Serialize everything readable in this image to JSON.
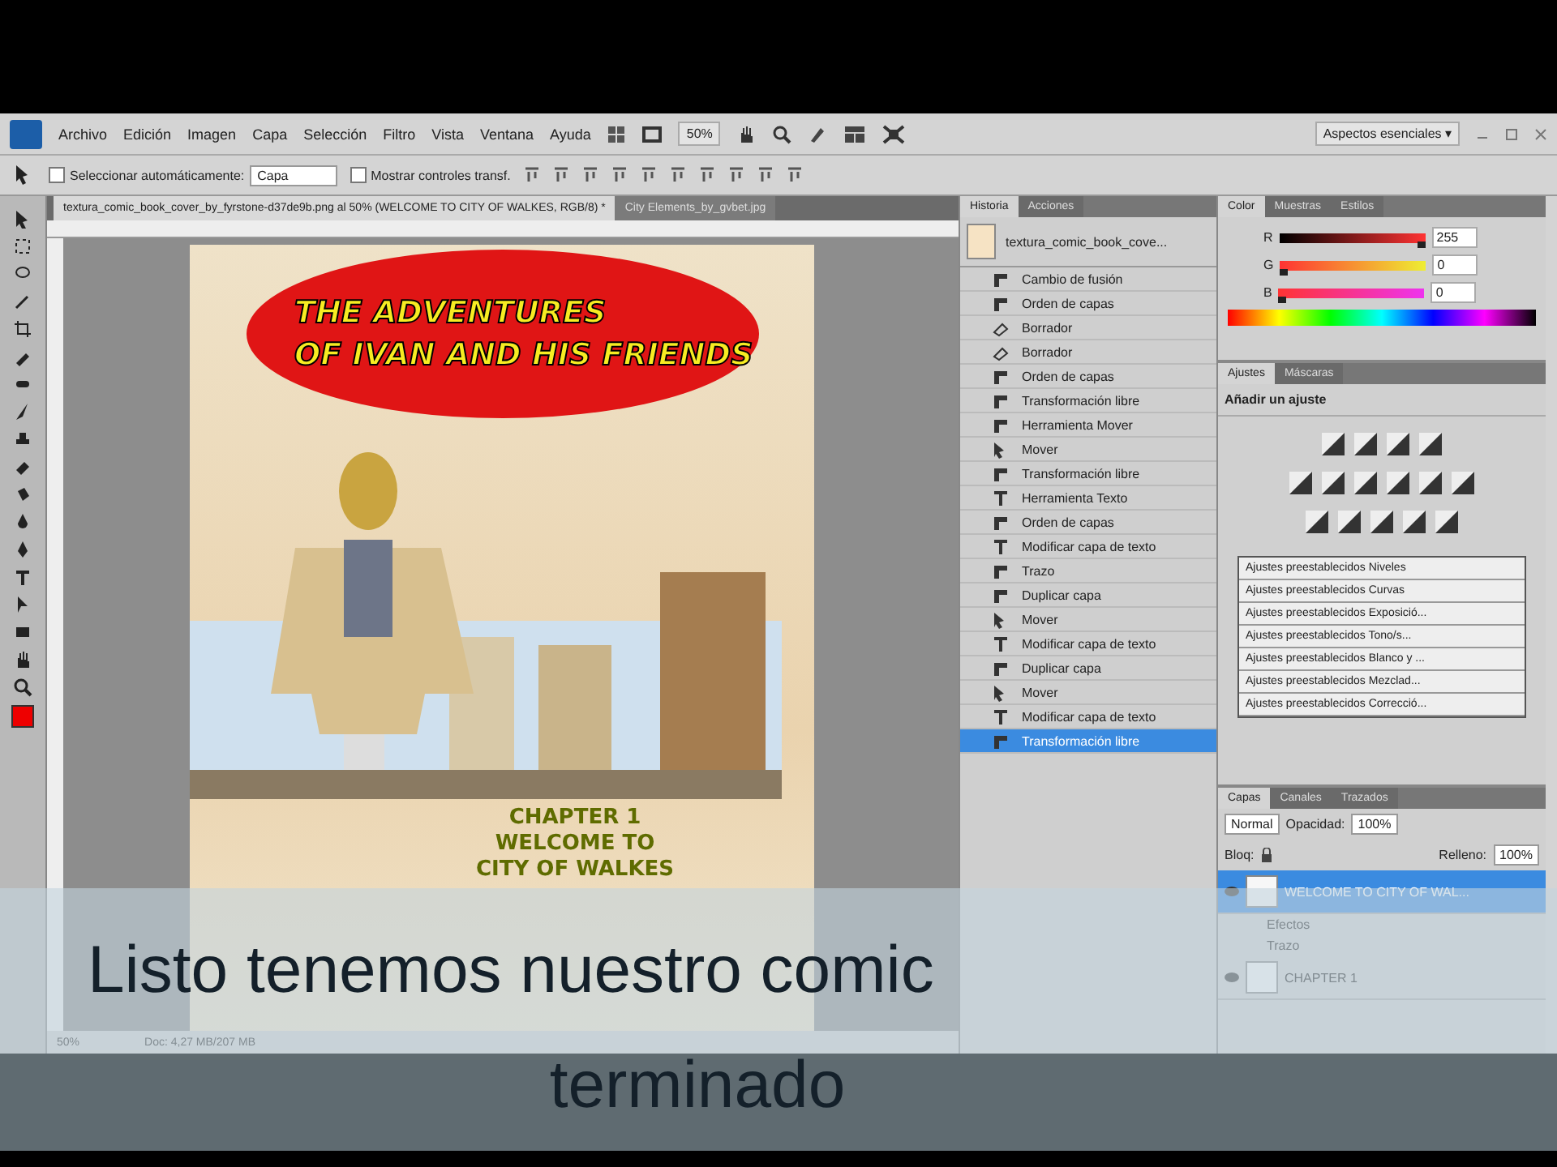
{
  "menu_bar": {
    "menus": [
      "Archivo",
      "Edición",
      "Imagen",
      "Capa",
      "Selección",
      "Filtro",
      "Vista",
      "Ventana",
      "Ayuda"
    ],
    "zoom": "50%",
    "workspace": "Aspectos esenciales ▾"
  },
  "options_bar": {
    "auto_select": {
      "label": "Seleccionar automáticamente:",
      "checked": false,
      "value": "Capa"
    },
    "show_transform": {
      "label": "Mostrar controles transf.",
      "checked": false
    }
  },
  "document_tabs": [
    {
      "label": "textura_comic_book_cover_by_fyrstone-d37de9b.png al 50% (WELCOME TO CITY OF WALKES, RGB/8) *",
      "selected": true
    },
    {
      "label": "City Elements_by_gvbet.jpg",
      "selected": false
    }
  ],
  "canvas": {
    "title_lines": [
      "THE ADVENTURES",
      "OF IVAN AND HIS FRIENDS"
    ],
    "chapter_lines": [
      "CHAPTER 1",
      "WELCOME TO",
      "CITY OF WALKES"
    ]
  },
  "status_bar": {
    "zoom": "50%",
    "doc": "Doc: 4,27 MB/207 MB"
  },
  "history_panel": {
    "tabs": [
      {
        "label": "Historia",
        "selected": true
      },
      {
        "label": "Acciones",
        "selected": false
      }
    ],
    "snapshot": "textura_comic_book_cove...",
    "items": [
      {
        "label": "Cambio de fusión",
        "kind": "layer",
        "selected": false
      },
      {
        "label": "Orden de capas",
        "kind": "layer",
        "selected": false
      },
      {
        "label": "Borrador",
        "kind": "eraser",
        "selected": false
      },
      {
        "label": "Borrador",
        "kind": "eraser",
        "selected": false
      },
      {
        "label": "Orden de capas",
        "kind": "layer",
        "selected": false
      },
      {
        "label": "Transformación libre",
        "kind": "layer",
        "selected": false
      },
      {
        "label": "Herramienta Mover",
        "kind": "layer",
        "selected": false
      },
      {
        "label": "Mover",
        "kind": "move",
        "selected": false
      },
      {
        "label": "Transformación libre",
        "kind": "layer",
        "selected": false
      },
      {
        "label": "Herramienta Texto",
        "kind": "text",
        "selected": false
      },
      {
        "label": "Orden de capas",
        "kind": "layer",
        "selected": false
      },
      {
        "label": "Modificar capa de texto",
        "kind": "text",
        "selected": false
      },
      {
        "label": "Trazo",
        "kind": "layer",
        "selected": false
      },
      {
        "label": "Duplicar capa",
        "kind": "layer",
        "selected": false
      },
      {
        "label": "Mover",
        "kind": "move",
        "selected": false
      },
      {
        "label": "Modificar capa de texto",
        "kind": "text",
        "selected": false
      },
      {
        "label": "Duplicar capa",
        "kind": "layer",
        "selected": false
      },
      {
        "label": "Mover",
        "kind": "move",
        "selected": false
      },
      {
        "label": "Modificar capa de texto",
        "kind": "text",
        "selected": false
      },
      {
        "label": "Transformación libre",
        "kind": "layer",
        "selected": true
      }
    ]
  },
  "color_panel": {
    "tabs": [
      {
        "label": "Color",
        "selected": true
      },
      {
        "label": "Muestras",
        "selected": false
      },
      {
        "label": "Estilos",
        "selected": false
      }
    ],
    "channels": [
      {
        "name": "R",
        "level": 1,
        "value": "255"
      },
      {
        "name": "G",
        "level": 0,
        "value": "0"
      },
      {
        "name": "B",
        "level": 0,
        "value": "0"
      }
    ]
  },
  "adjustments_panel": {
    "tabs": [
      {
        "label": "Ajustes",
        "selected": true
      },
      {
        "label": "Máscaras",
        "selected": false
      }
    ],
    "heading": "Añadir un ajuste",
    "presets": [
      "Ajustes preestablecidos Niveles",
      "Ajustes preestablecidos Curvas",
      "Ajustes preestablecidos Exposició...",
      "Ajustes preestablecidos Tono/s...",
      "Ajustes preestablecidos Blanco y ...",
      "Ajustes preestablecidos Mezclad...",
      "Ajustes preestablecidos Correcció..."
    ]
  },
  "layers_panel": {
    "tabs": [
      {
        "label": "Capas",
        "selected": true
      },
      {
        "label": "Canales",
        "selected": false
      },
      {
        "label": "Trazados",
        "selected": false
      }
    ],
    "blend_mode": "Normal",
    "opacity_label": "Opacidad:",
    "opacity": "100%",
    "lock_label": "Bloq:",
    "fill_label": "Relleno:",
    "fill": "100%",
    "layers": [
      {
        "name": "WELCOME TO CITY OF WAL...",
        "selected": true,
        "visible": true,
        "effects": [
          "Efectos",
          "Trazo"
        ]
      },
      {
        "name": "CHAPTER 1",
        "selected": false,
        "visible": true
      }
    ]
  },
  "subtitle": {
    "lines": [
      "Listo tenemos nuestro comic",
      "terminado"
    ]
  }
}
